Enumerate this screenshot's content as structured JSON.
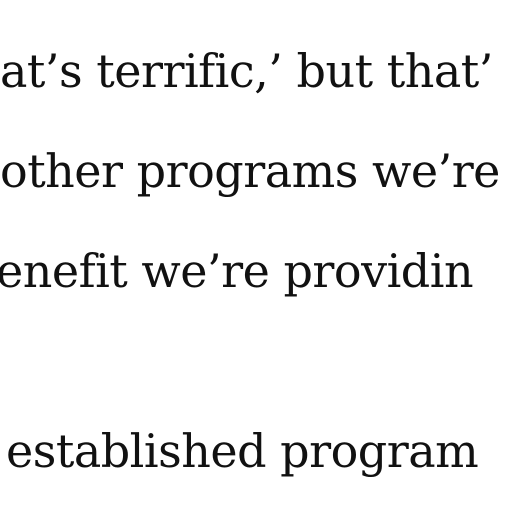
{
  "article": {
    "lines": [
      "at’s terrific,’ but that’",
      "other programs we’re",
      "enefit we’re providin",
      "established program"
    ]
  }
}
